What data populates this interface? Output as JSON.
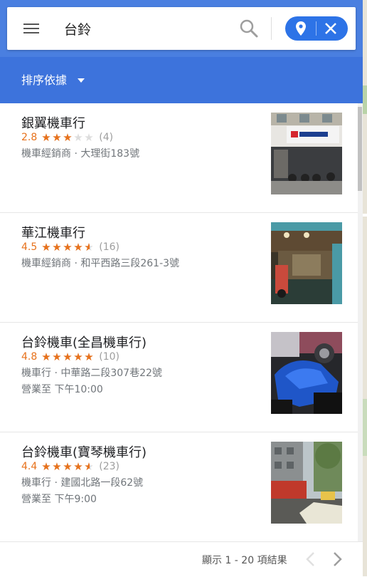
{
  "search": {
    "query": "台鈴"
  },
  "sort": {
    "label": "排序依據"
  },
  "results": [
    {
      "name": "銀翼機車行",
      "rating": "2.8",
      "rating_value": 2.8,
      "reviews": "(4)",
      "category_address": "機車經銷商 · 大理街183號",
      "hours": ""
    },
    {
      "name": "華江機車行",
      "rating": "4.5",
      "rating_value": 4.5,
      "reviews": "(16)",
      "category_address": "機車經銷商 · 和平西路三段261-3號",
      "hours": ""
    },
    {
      "name": "台鈴機車(全昌機車行)",
      "rating": "4.8",
      "rating_value": 4.8,
      "reviews": "(10)",
      "category_address": "機車行 · 中華路二段307巷22號",
      "hours": "營業至 下午10:00"
    },
    {
      "name": "台鈴機車(寶琴機車行)",
      "rating": "4.4",
      "rating_value": 4.4,
      "reviews": "(23)",
      "category_address": "機車行 · 建國北路一段62號",
      "hours": "營業至 下午9:00"
    }
  ],
  "pagination": {
    "text": "顯示 1 - 20 項結果"
  },
  "colors": {
    "accent": "#4a7fe0",
    "star": "#e7711b",
    "pill": "#2d73e7"
  },
  "icons": [
    "menu-icon",
    "search-icon",
    "location-pin-icon",
    "close-icon",
    "caret-down-icon",
    "chevron-left-icon",
    "chevron-right-icon"
  ]
}
